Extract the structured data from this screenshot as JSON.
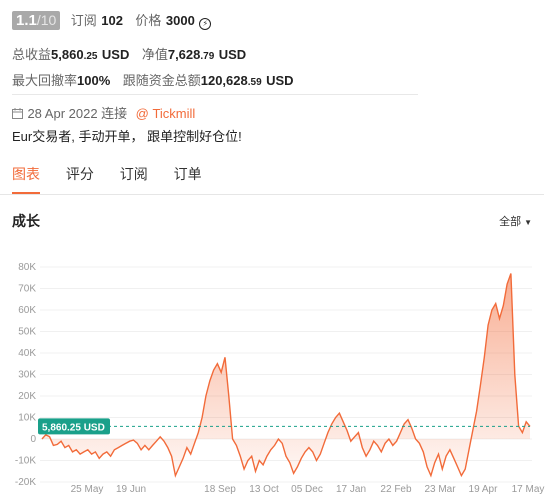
{
  "header": {
    "rating": "1.1",
    "rating_max": "/10",
    "subscriptions_label": "订阅",
    "subscriptions_value": "102",
    "price_label": "价格",
    "price_value": "3000"
  },
  "stats": {
    "total_profit_label": "总收益",
    "total_profit_main": "5,860",
    "total_profit_dec": ".25",
    "total_profit_unit": "USD",
    "net_label": "净值",
    "net_main": "7,628",
    "net_dec": ".79",
    "net_unit": "USD",
    "drawdown_label": "最大回撤率",
    "drawdown_value": "100%",
    "follow_label": "跟随资金总额",
    "follow_main": "120,628",
    "follow_dec": ".59",
    "follow_unit": "USD"
  },
  "meta": {
    "date": "28 Apr 2022 连接",
    "broker": "@ Tickmill",
    "description": "Eur交易者, 手动开单， 跟单控制好仓位!"
  },
  "tabs": [
    {
      "label": "图表",
      "active": true
    },
    {
      "label": "评分",
      "active": false
    },
    {
      "label": "订阅",
      "active": false
    },
    {
      "label": "订单",
      "active": false
    }
  ],
  "section": {
    "title": "成长",
    "filter_label": "全部"
  },
  "chart_data": {
    "type": "area",
    "title": "成长",
    "ylim": [
      -20000,
      80000
    ],
    "y_ticks": [
      "80K",
      "70K",
      "60K",
      "50K",
      "40K",
      "30K",
      "20K",
      "10K",
      "0",
      "-10K",
      "-20K"
    ],
    "x_ticks": [
      "25 May",
      "19 Jun",
      "18 Sep",
      "13 Oct",
      "05 Dec",
      "17 Jan",
      "22 Feb",
      "23 Mar",
      "19 Apr",
      "17 May"
    ],
    "current_value_label": "5,860.25 USD",
    "current_value": 5860.25,
    "line_color": "#f26b3a",
    "baseline_color": "#1aa08a",
    "values": [
      0,
      2000,
      1000,
      -3000,
      -2500,
      -1000,
      -4000,
      -3000,
      -6000,
      -5000,
      -7000,
      -6000,
      -5000,
      -7000,
      -6000,
      -9000,
      -7000,
      -6000,
      -8000,
      -5000,
      -4000,
      -3000,
      -2000,
      -1000,
      -500,
      -2000,
      -5000,
      -3000,
      -5000,
      -3000,
      -1000,
      1000,
      -1000,
      -4000,
      -8000,
      -17000,
      -13000,
      -9000,
      -4000,
      -7000,
      -2000,
      3000,
      10000,
      20000,
      27000,
      32000,
      35000,
      31000,
      38000,
      20000,
      0,
      -3000,
      -8000,
      -14000,
      -10000,
      -8000,
      -15000,
      -10000,
      -12000,
      -8000,
      -5000,
      -3000,
      0,
      -2000,
      -8000,
      -11000,
      -16000,
      -13000,
      -9000,
      -6000,
      -4000,
      -6000,
      -10000,
      -7000,
      -2000,
      3000,
      7000,
      10000,
      12000,
      8000,
      4000,
      -1000,
      1000,
      3000,
      -4000,
      -8000,
      -5000,
      -1000,
      -3000,
      -6000,
      -2000,
      0,
      -3000,
      -1000,
      3000,
      7000,
      9000,
      5000,
      0,
      -2000,
      -6000,
      -13000,
      -17000,
      -11000,
      -7000,
      -14000,
      -8000,
      -5000,
      -9000,
      -13000,
      -17000,
      -14000,
      -5000,
      4000,
      13000,
      25000,
      38000,
      53000,
      60000,
      63000,
      56000,
      62000,
      72000,
      77000,
      30000,
      6000,
      3000,
      8000,
      5860
    ]
  }
}
